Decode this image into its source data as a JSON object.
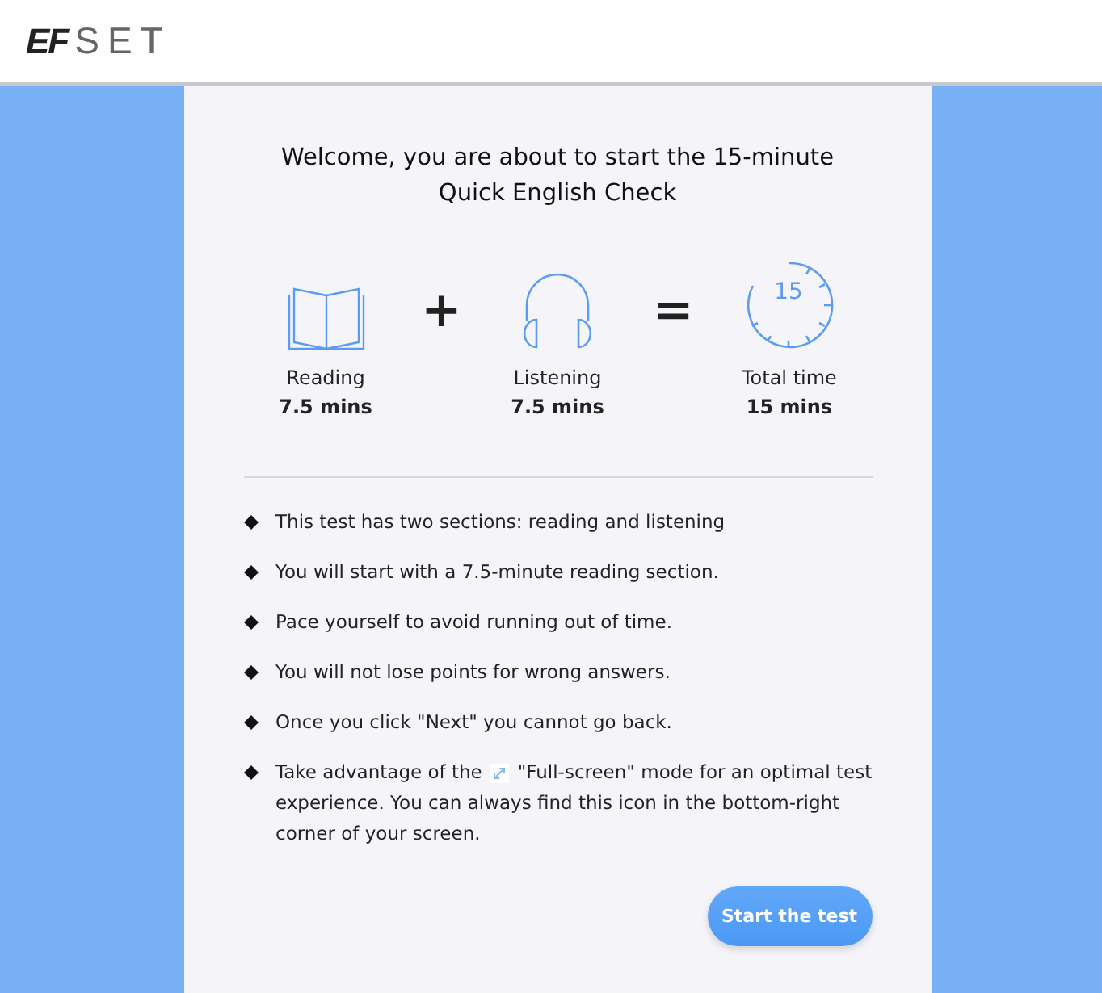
{
  "header": {
    "logo_bold": "EF",
    "logo_light": "SET"
  },
  "intro": {
    "title": "Welcome, you are about to start the 15-minute Quick English Check"
  },
  "summary": [
    {
      "kind": "book",
      "label": "Reading",
      "value": "7.5 mins"
    },
    {
      "kind": "operator",
      "symbol": "+"
    },
    {
      "kind": "headphones",
      "label": "Listening",
      "value": "7.5 mins"
    },
    {
      "kind": "operator",
      "symbol": "="
    },
    {
      "kind": "timer",
      "timer_text": "15",
      "label": "Total time",
      "value": "15 mins"
    }
  ],
  "rules": [
    {
      "text": "This test has two sections: reading and listening"
    },
    {
      "text": "You will start with a 7.5-minute reading section."
    },
    {
      "text": "Pace yourself to avoid running out of time."
    },
    {
      "text": "You will not lose points for wrong answers."
    },
    {
      "text": "Once you click \"Next\" you cannot go back."
    },
    {
      "text": "Take advantage of the",
      "text_after_icon": "\"Full-screen\" mode for an optimal test",
      "text_continued": "experience. You can always find this icon in the bottom-right corner of your screen."
    }
  ],
  "start_button": "Start the test"
}
